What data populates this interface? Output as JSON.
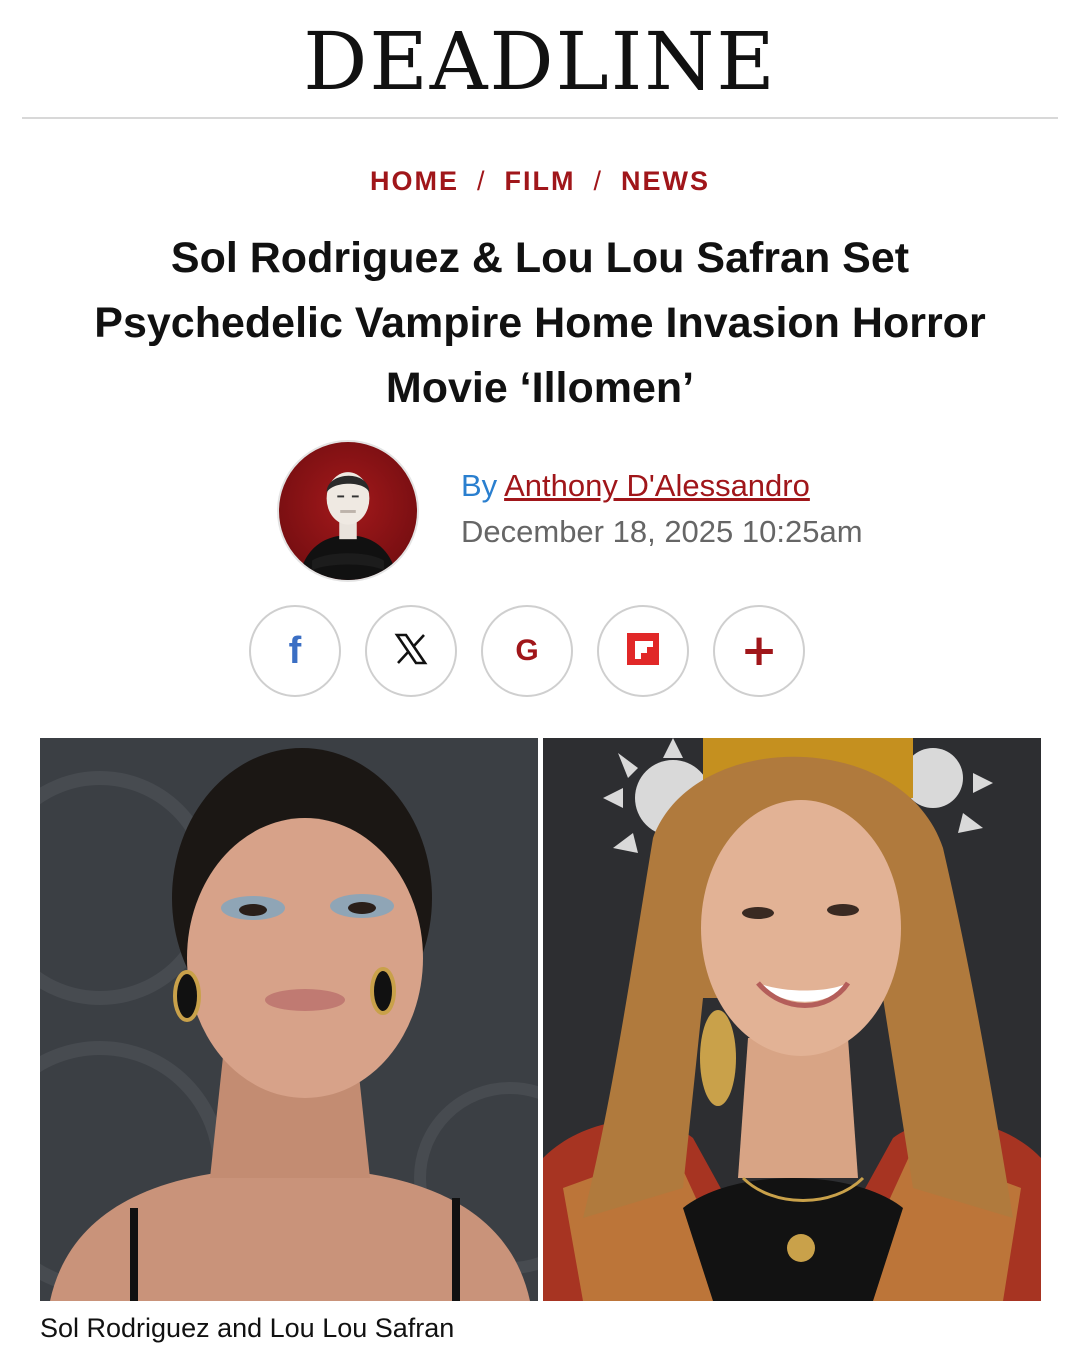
{
  "masthead": {
    "logo": "DEADLINE"
  },
  "breadcrumb": {
    "items": [
      {
        "label": "HOME"
      },
      {
        "label": "FILM"
      },
      {
        "label": "NEWS"
      }
    ],
    "separator": "/"
  },
  "article": {
    "headline": "Sol Rodriguez & Lou Lou Safran Set Psychedelic Vampire Home Invasion Horror Movie ‘Illomen’",
    "by_prefix": "By",
    "author": "Anthony D'Alessandro",
    "date": "December 18, 2025 10:25am",
    "photo_caption": "Sol Rodriguez and Lou Lou Safran"
  },
  "share": {
    "buttons": [
      {
        "name": "facebook",
        "glyph": "f",
        "color": "#3b6fc4"
      },
      {
        "name": "x",
        "glyph": "𝕏",
        "color": "#111111"
      },
      {
        "name": "google",
        "glyph": "G",
        "color": "#a0161a"
      },
      {
        "name": "flipboard",
        "glyph": "",
        "color": "#e12828"
      },
      {
        "name": "more",
        "glyph": "+",
        "color": "#a0161a"
      }
    ]
  },
  "colors": {
    "brand_red": "#a0161a",
    "byline_blue": "#2a7fcf",
    "muted_text": "#666666"
  }
}
